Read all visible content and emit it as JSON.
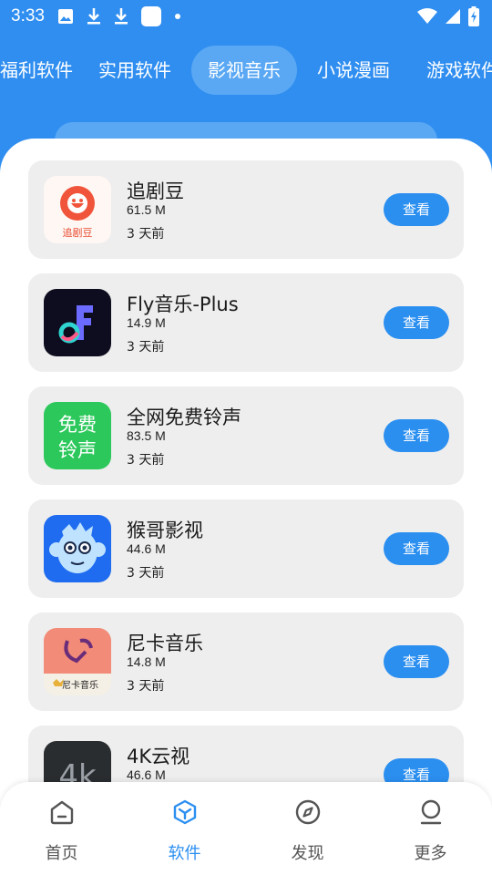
{
  "status_bar": {
    "time": "3:33",
    "icons": [
      "image-icon",
      "download-icon",
      "download-icon",
      "app-square-icon",
      "dot-icon",
      "wifi-icon",
      "signal-icon",
      "battery-icon"
    ]
  },
  "tabs": [
    {
      "label": "福利软件",
      "active": false
    },
    {
      "label": "实用软件",
      "active": false
    },
    {
      "label": "影视音乐",
      "active": true
    },
    {
      "label": "小说漫画",
      "active": false
    },
    {
      "label": "游戏软件",
      "active": false
    }
  ],
  "apps": [
    {
      "name": "追剧豆",
      "size": "61.5 M",
      "time": "3 天前",
      "button": "查看",
      "icon": "zhuijudou-icon",
      "icon_text": "追剧豆"
    },
    {
      "name": "Fly音乐-Plus",
      "size": "14.9 M",
      "time": "3 天前",
      "button": "查看",
      "icon": "fly-music-icon"
    },
    {
      "name": "全网免费铃声",
      "size": "83.5 M",
      "time": "3 天前",
      "button": "查看",
      "icon": "ringtone-icon",
      "icon_text_1": "免费",
      "icon_text_2": "铃声"
    },
    {
      "name": "猴哥影视",
      "size": "44.6 M",
      "time": "3 天前",
      "button": "查看",
      "icon": "monkey-icon"
    },
    {
      "name": "尼卡音乐",
      "size": "14.8 M",
      "time": "3 天前",
      "button": "查看",
      "icon": "nika-music-icon",
      "icon_text": "尼卡音乐"
    },
    {
      "name": "4K云视",
      "size": "46.6 M",
      "time": "",
      "button": "查看",
      "icon": "4k-icon"
    }
  ],
  "bottom_nav": [
    {
      "label": "首页",
      "icon": "home-icon",
      "active": false
    },
    {
      "label": "软件",
      "icon": "software-cube-icon",
      "active": true
    },
    {
      "label": "发现",
      "icon": "compass-icon",
      "active": false
    },
    {
      "label": "更多",
      "icon": "user-icon",
      "active": false
    }
  ],
  "colors": {
    "header_blue": "#2f8ef0",
    "active_tab": "#5aa8f4",
    "button_blue": "#2b8ff0",
    "card_bg": "#eeeeee"
  }
}
